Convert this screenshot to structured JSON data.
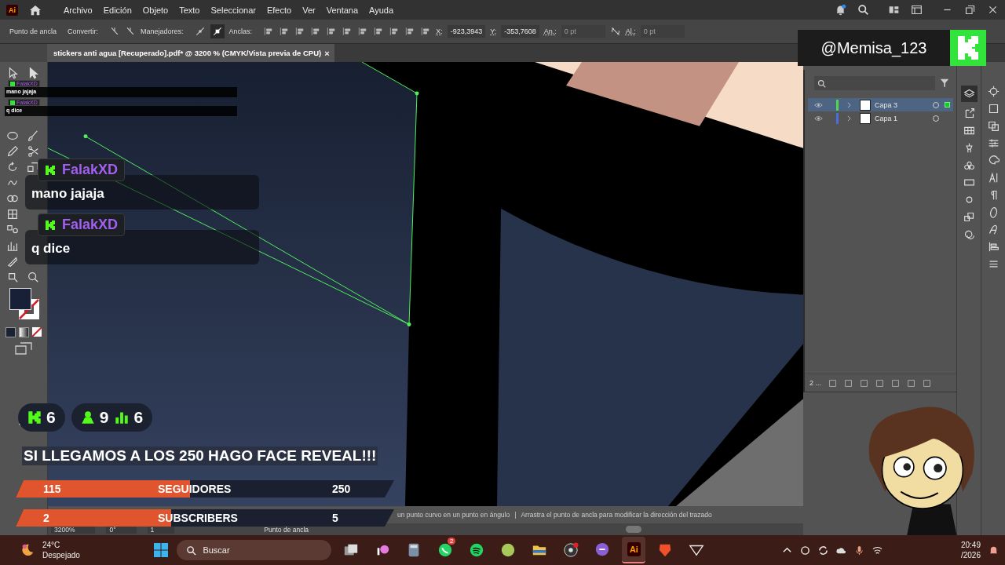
{
  "app_logo": "Ai",
  "menu": [
    "Archivo",
    "Edición",
    "Objeto",
    "Texto",
    "Seleccionar",
    "Efecto",
    "Ver",
    "Ventana",
    "Ayuda"
  ],
  "control_bar": {
    "tool_label": "Punto de ancla",
    "convert_label": "Convertir:",
    "handles_label": "Manejadores:",
    "anchors_label": "Anclas:",
    "x_label": "X:",
    "x_value": "-923,3943",
    "y_label": "Y:",
    "y_value": "-353,7608",
    "width_label": "An.:",
    "width_value": "0 pt",
    "width_disabled": true,
    "height_label": "Al.:",
    "height_value": "0 pt",
    "height_disabled": true
  },
  "document_tab": {
    "title": "stickers anti agua [Recuperado].pdf* @ 3200 % (CMYK/Vista previa de CPU)",
    "close": "×"
  },
  "layers_panel": {
    "layers": [
      {
        "name": "Capa 3",
        "color": "#4cd94c",
        "selected": true
      },
      {
        "name": "Capa 1",
        "color": "#4a6ee0",
        "selected": false
      }
    ],
    "footer_count": "2 ..."
  },
  "status_bar": {
    "hint_part_1": "un punto curvo en un punto en ángulo",
    "separator": "|",
    "hint_part_2": "Arrastra el punto de ancla para modificar la dirección del trazado",
    "zoom": "3200%",
    "rotation": "0°",
    "artboard": "1",
    "tool": "Punto de ancla"
  },
  "stream_overlay": {
    "handle": "@Memisa_123",
    "mini_chat": [
      {
        "user": "FalakXD",
        "message": "mano jajaja"
      },
      {
        "user": "FalakXD",
        "message": "q dice"
      }
    ],
    "chat": [
      {
        "user": "FalakXD",
        "message": "mano jajaja"
      },
      {
        "user": "FalakXD",
        "message": "q dice"
      }
    ],
    "stats": [
      {
        "kind": "kick",
        "value": "6"
      },
      {
        "kind": "followers",
        "value": "9"
      },
      {
        "kind": "viewers",
        "value": "6"
      }
    ],
    "banner": "SI LLEGAMOS A LOS 250 HAGO FACE REVEAL!!!",
    "goals": [
      {
        "current": "115",
        "label": "SEGUIDORES",
        "target": "250",
        "level": 0.46
      },
      {
        "current": "2",
        "label": "SUBSCRIBERS",
        "target": "5",
        "level": 0.41
      }
    ]
  },
  "taskbar": {
    "temperature": "24°C",
    "weather": "Despejado",
    "search_placeholder": "Buscar",
    "apps": [
      {
        "kind": "taskview",
        "selected": false
      },
      {
        "kind": "paint",
        "selected": false
      },
      {
        "kind": "calculator",
        "selected": false
      },
      {
        "kind": "whatsapp",
        "selected": false,
        "badge": "2"
      },
      {
        "kind": "spotify",
        "selected": false
      },
      {
        "kind": "ball",
        "selected": false
      },
      {
        "kind": "folder",
        "selected": false
      },
      {
        "kind": "obs",
        "selected": false
      },
      {
        "kind": "chat",
        "selected": false
      },
      {
        "kind": "illustrator",
        "selected": true,
        "label": "Ai"
      },
      {
        "kind": "brave",
        "selected": false
      },
      {
        "kind": "triangle",
        "selected": false
      }
    ],
    "time": "20:49",
    "date": "/2026"
  }
}
